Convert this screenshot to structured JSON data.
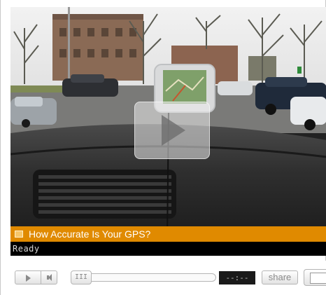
{
  "video": {
    "title": "How Accurate Is Your GPS?",
    "status": "Ready",
    "play_overlay_icon": "play-icon"
  },
  "controls": {
    "play_icon": "play-icon",
    "volume_icon": "speaker-icon",
    "seek_handle_text": "III",
    "time_display": "--:--",
    "share_label": "share",
    "fullscreen_icon": "fullscreen-icon"
  },
  "colors": {
    "title_bar": "#e08a00",
    "status_bar": "#000000",
    "time_display_bg": "#1a1a1a"
  }
}
